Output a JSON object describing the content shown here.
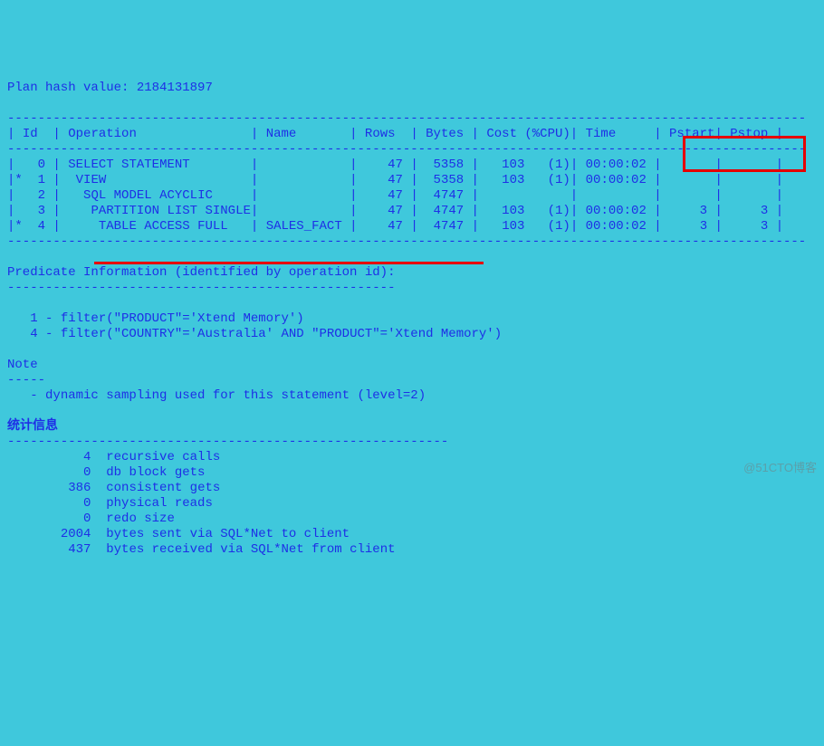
{
  "header": {
    "plan_hash_label": "Plan hash value:",
    "plan_hash": "2184131897"
  },
  "columns": {
    "id": "Id",
    "operation": "Operation",
    "name": "Name",
    "rows": "Rows",
    "bytes": "Bytes",
    "cost": "Cost (%CPU)",
    "time": "Time",
    "pstart": "Pstart",
    "pstop": "Pstop"
  },
  "rows": [
    {
      "star": " ",
      "id": "0",
      "op": "SELECT STATEMENT",
      "name": "",
      "rows": "47",
      "bytes": "5358",
      "cost": "103",
      "cpu": "(1)",
      "time": "00:00:02",
      "pstart": "",
      "pstop": ""
    },
    {
      "star": "*",
      "id": "1",
      "op": " VIEW",
      "name": "",
      "rows": "47",
      "bytes": "5358",
      "cost": "103",
      "cpu": "(1)",
      "time": "00:00:02",
      "pstart": "",
      "pstop": ""
    },
    {
      "star": " ",
      "id": "2",
      "op": "  SQL MODEL ACYCLIC",
      "name": "",
      "rows": "47",
      "bytes": "4747",
      "cost": "",
      "cpu": "",
      "time": "",
      "pstart": "",
      "pstop": ""
    },
    {
      "star": " ",
      "id": "3",
      "op": "   PARTITION LIST SINGLE",
      "name": "",
      "rows": "47",
      "bytes": "4747",
      "cost": "103",
      "cpu": "(1)",
      "time": "00:00:02",
      "pstart": "3",
      "pstop": "3"
    },
    {
      "star": "*",
      "id": "4",
      "op": "    TABLE ACCESS FULL",
      "name": "SALES_FACT",
      "rows": "47",
      "bytes": "4747",
      "cost": "103",
      "cpu": "(1)",
      "time": "00:00:02",
      "pstart": "3",
      "pstop": "3"
    }
  ],
  "predicate": {
    "title": "Predicate Information (identified by operation id):",
    "lines": [
      "1 - filter(\"PRODUCT\"='Xtend Memory')",
      "4 - filter(\"COUNTRY\"='Australia' AND \"PRODUCT\"='Xtend Memory')"
    ]
  },
  "note": {
    "label": "Note",
    "line": "- dynamic sampling used for this statement (level=2)"
  },
  "stats": {
    "label": "统计信息",
    "items": [
      {
        "n": "4",
        "t": "recursive calls"
      },
      {
        "n": "0",
        "t": "db block gets"
      },
      {
        "n": "386",
        "t": "consistent gets"
      },
      {
        "n": "0",
        "t": "physical reads"
      },
      {
        "n": "0",
        "t": "redo size"
      },
      {
        "n": "2004",
        "t": "bytes sent via SQL*Net to client"
      },
      {
        "n": "437",
        "t": "bytes received via SQL*Net from client"
      }
    ]
  },
  "watermark": "@51CTO博客",
  "chart_data": {
    "type": "table",
    "title": "Oracle Execution Plan",
    "plan_hash": 2184131897,
    "columns": [
      "Id",
      "Operation",
      "Name",
      "Rows",
      "Bytes",
      "Cost",
      "%CPU",
      "Time",
      "Pstart",
      "Pstop"
    ],
    "rows": [
      [
        0,
        "SELECT STATEMENT",
        "",
        47,
        5358,
        103,
        1,
        "00:00:02",
        null,
        null
      ],
      [
        1,
        "VIEW",
        "",
        47,
        5358,
        103,
        1,
        "00:00:02",
        null,
        null
      ],
      [
        2,
        "SQL MODEL ACYCLIC",
        "",
        47,
        4747,
        null,
        null,
        null,
        null,
        null
      ],
      [
        3,
        "PARTITION LIST SINGLE",
        "",
        47,
        4747,
        103,
        1,
        "00:00:02",
        3,
        3
      ],
      [
        4,
        "TABLE ACCESS FULL",
        "SALES_FACT",
        47,
        4747,
        103,
        1,
        "00:00:02",
        3,
        3
      ]
    ],
    "predicates": {
      "1": "filter(\"PRODUCT\"='Xtend Memory')",
      "4": "filter(\"COUNTRY\"='Australia' AND \"PRODUCT\"='Xtend Memory')"
    },
    "note": "dynamic sampling used for this statement (level=2)",
    "statistics": {
      "recursive calls": 4,
      "db block gets": 0,
      "consistent gets": 386,
      "physical reads": 0,
      "redo size": 0,
      "bytes sent via SQL*Net to client": 2004,
      "bytes received via SQL*Net from client": 437
    }
  }
}
